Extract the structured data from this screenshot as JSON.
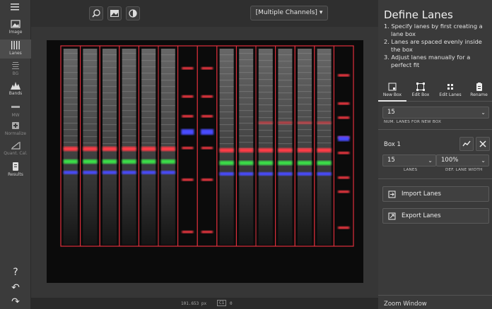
{
  "leftbar": {
    "items": [
      {
        "label": "Image",
        "icon": "image-icon"
      },
      {
        "label": "Lanes",
        "icon": "lanes-icon"
      },
      {
        "label": "BG",
        "icon": "background-icon"
      },
      {
        "label": "Bands",
        "icon": "bands-icon"
      },
      {
        "label": "MW",
        "icon": "molecular-weight-icon"
      },
      {
        "label": "Normalize",
        "icon": "normalize-icon"
      },
      {
        "label": "Quant. Cal.",
        "icon": "quant-calibration-icon"
      },
      {
        "label": "Results",
        "icon": "results-icon"
      }
    ],
    "bottom": [
      {
        "glyph": "?",
        "icon": "help-icon"
      },
      {
        "glyph": "↶",
        "icon": "undo-icon"
      },
      {
        "glyph": "↷",
        "icon": "redo-icon"
      }
    ]
  },
  "topbar": {
    "channel_select": "[Multiple Channels]"
  },
  "status": {
    "coords": "101.653 px",
    "channel": "C1",
    "extra": "0"
  },
  "panel": {
    "title": "Define Lanes",
    "steps": [
      "1. Specify lanes by first creating a lane box",
      "2. Lanes are spaced evenly inside the box",
      "3. Adjust lanes manually for a perfect fit"
    ],
    "tabs": [
      {
        "label": "New Box",
        "icon": "new-box-icon"
      },
      {
        "label": "Edit Box",
        "icon": "edit-box-icon"
      },
      {
        "label": "Edit Lanes",
        "icon": "edit-lanes-icon"
      },
      {
        "label": "Rename",
        "icon": "rename-icon"
      }
    ],
    "num_lanes": {
      "value": "15",
      "caption": "NUM. LANES FOR NEW BOX"
    },
    "box": {
      "label": "Box 1",
      "lanes_value": "15",
      "lanes_caption": "LANES",
      "width_value": "100%",
      "width_caption": "DEF. LANE WIDTH"
    },
    "import_label": "Import Lanes",
    "export_label": "Export Lanes",
    "zoom_label": "Zoom Window"
  },
  "colors": {
    "lane_box": "#e0303c",
    "band_red": "#ff3b45",
    "band_green": "#3be04a",
    "band_blue": "#4a4cff"
  }
}
